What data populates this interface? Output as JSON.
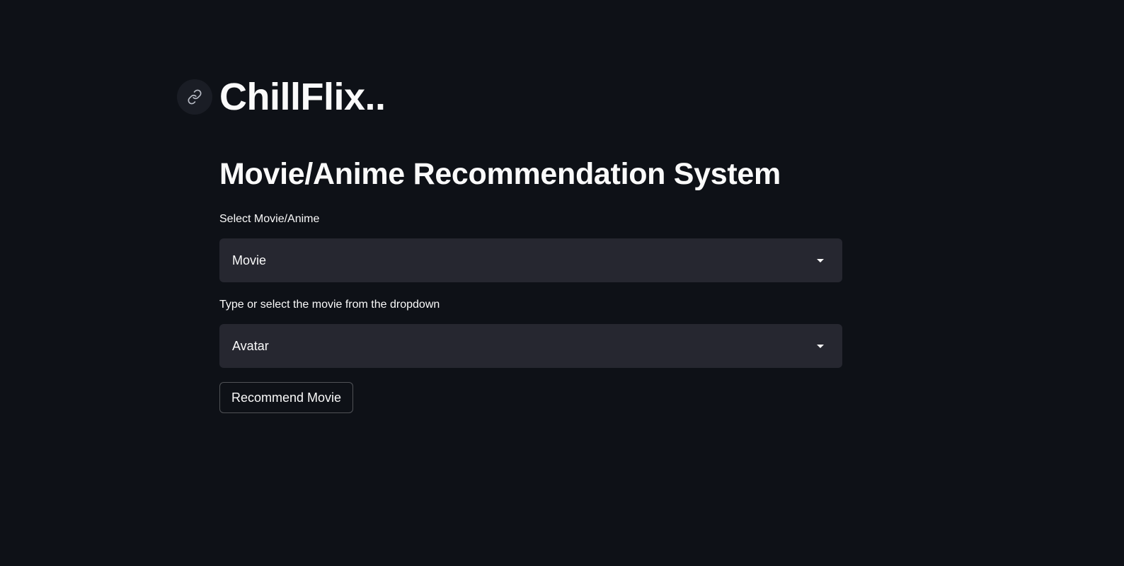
{
  "header": {
    "title": "ChillFlix..",
    "anchor_icon": "link-icon"
  },
  "main": {
    "subtitle": "Movie/Anime Recommendation System",
    "category_select": {
      "label": "Select Movie/Anime",
      "value": "Movie"
    },
    "title_select": {
      "label": "Type or select the movie from the dropdown",
      "value": "Avatar"
    },
    "recommend_button": {
      "label": "Recommend Movie"
    }
  },
  "colors": {
    "background": "#0e1117",
    "select_background": "#262730",
    "text": "#fafafa"
  }
}
